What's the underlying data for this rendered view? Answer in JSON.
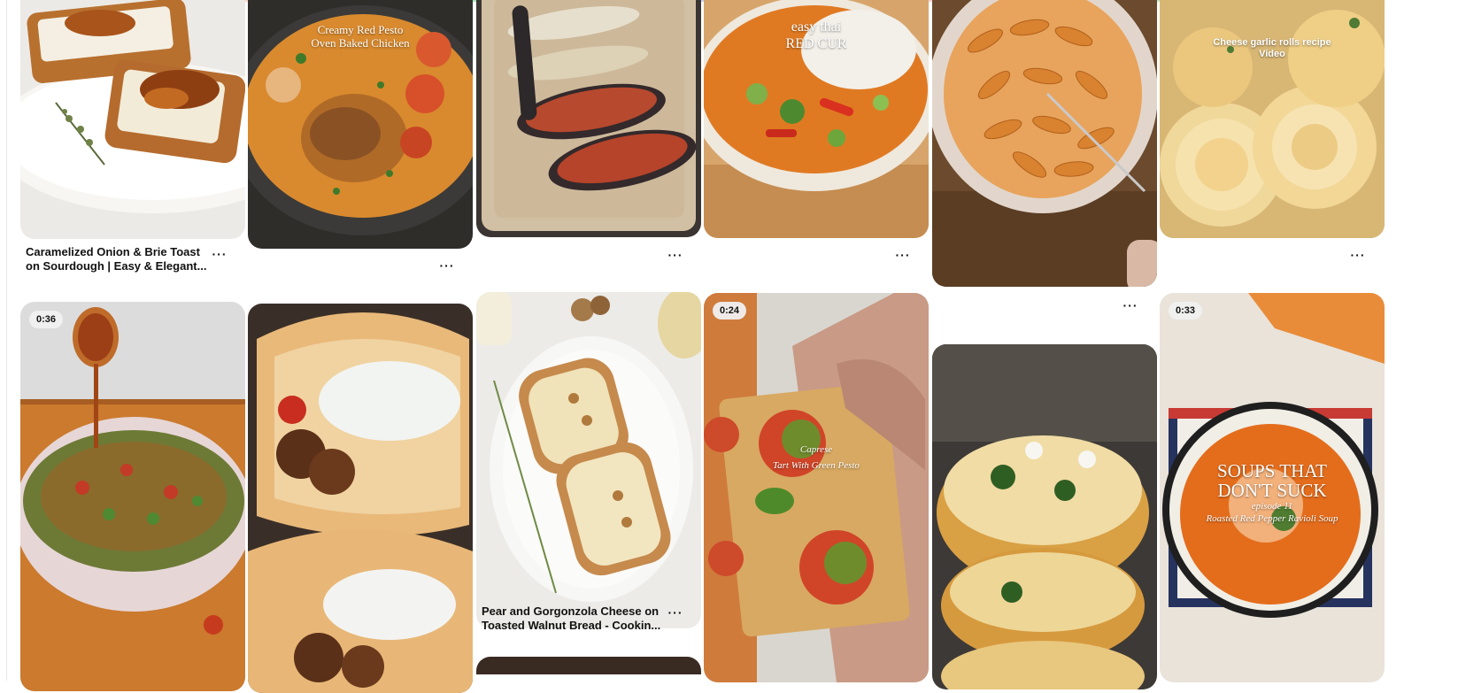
{
  "chips": [
    {
      "color": "#ffcdb0"
    },
    {
      "color": "#fcd4c8"
    },
    {
      "color": "#b9ebd2"
    },
    {
      "color": "#a8e6bd"
    },
    {
      "color": "#c8d4f6"
    },
    {
      "color": "#c9cff7"
    },
    {
      "color": "#e2d1f5"
    },
    {
      "color": "#f7cfcc"
    },
    {
      "color": "#fdd3c7"
    },
    {
      "color": "#bde8cc"
    },
    {
      "color": "#a7e0c2"
    }
  ],
  "pins": [
    {
      "id": "onion-brie",
      "title": "Caramelized Onion & Brie Toast on Sourdough | Easy & Elegant...",
      "more": "···",
      "overlay_lines": [],
      "duration": ""
    },
    {
      "id": "red-pesto-chicken",
      "title": "",
      "more": "···",
      "overlay_lines": [
        "Creamy Red Pesto",
        "Oven Baked Chicken"
      ],
      "duration": ""
    },
    {
      "id": "eggplant",
      "title": "",
      "more": "···",
      "overlay_lines": [],
      "duration": ""
    },
    {
      "id": "thai-curry",
      "title": "",
      "more": "···",
      "overlay_lines": [
        "easy thai",
        "RED CUR"
      ],
      "duration": ""
    },
    {
      "id": "peach-galette",
      "title": "",
      "more": "···",
      "overlay_lines": [],
      "duration": ""
    },
    {
      "id": "garlic-rolls",
      "title": "",
      "more": "···",
      "overlay_lines": [
        "Cheese garlic rolls recipe",
        "Video"
      ],
      "duration": ""
    },
    {
      "id": "chili-salad",
      "title": "",
      "more": "",
      "overlay_lines": [],
      "duration": "0:36"
    },
    {
      "id": "chicken-gyro",
      "title": "",
      "more": "",
      "overlay_lines": [],
      "duration": ""
    },
    {
      "id": "pear-gorgonzola",
      "title": "Pear and Gorgonzola Cheese on Toasted Walnut Bread - Cookin...",
      "more": "···",
      "overlay_lines": [],
      "duration": ""
    },
    {
      "id": "caprese-tart",
      "title": "",
      "more": "",
      "overlay_lines": [
        "Caprese",
        "Tart With Green Pesto"
      ],
      "duration": "0:24"
    },
    {
      "id": "egg-muffins",
      "title": "",
      "more": "",
      "overlay_lines": [],
      "duration": ""
    },
    {
      "id": "pepper-soup",
      "title": "",
      "more": "",
      "overlay_lines": [
        "SOUPS THAT",
        "DON'T SUCK",
        "episode 11",
        "Roasted Red Pepper Ravioli Soup"
      ],
      "duration": "0:33"
    }
  ]
}
